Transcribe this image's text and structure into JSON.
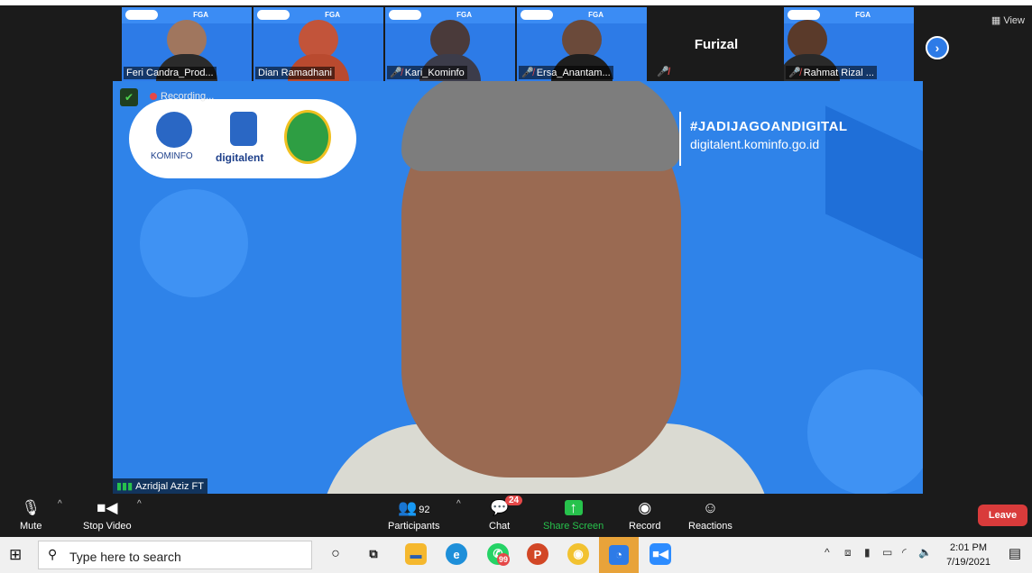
{
  "thumbnails": [
    {
      "name": "Feri Candra_Prod...",
      "muted": false,
      "fga": "FGA"
    },
    {
      "name": "Dian Ramadhani",
      "muted": false,
      "fga": "FGA"
    },
    {
      "name": "Kari_Kominfo",
      "muted": true,
      "fga": "FGA"
    },
    {
      "name": "Ersa_Anantam...",
      "muted": true,
      "fga": "FGA"
    },
    {
      "name": "Rahmat Rizal ...",
      "muted": true,
      "fga": "FGA"
    }
  ],
  "name_only_tile": {
    "name": "Furizal",
    "muted": true
  },
  "view_label": "View",
  "main": {
    "recording_label": "Recording...",
    "logos": {
      "kominfo": "KOMINFO",
      "digitalent": "digitalent"
    },
    "hashtag": "#JADIJAGOANDIGITAL",
    "url": "digitalent.kominfo.go.id",
    "speaker_name": "Azridjal Aziz FT"
  },
  "toolbar": {
    "mute": "Mute",
    "stop_video": "Stop Video",
    "participants": "Participants",
    "participants_count": "92",
    "chat": "Chat",
    "chat_badge": "24",
    "share_screen": "Share Screen",
    "record": "Record",
    "reactions": "Reactions",
    "leave": "Leave"
  },
  "taskbar": {
    "search_placeholder": "Type here to search",
    "whatsapp_badge": "99",
    "time": "2:01 PM",
    "date": "7/19/2021"
  },
  "colors": {
    "accent": "#2d7be7",
    "leave": "#d93b3b",
    "share": "#27c24c",
    "mute_red": "#e54848"
  }
}
